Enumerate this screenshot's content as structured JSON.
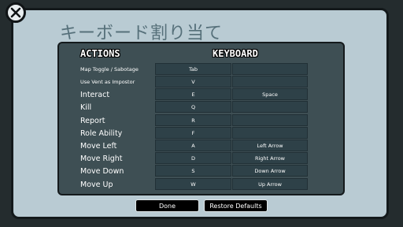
{
  "title": "キーボード割り当て",
  "headers": {
    "actions": "ACTIONS",
    "keyboard": "KEYBOARD"
  },
  "rows": [
    {
      "action": "Map Toggle / Sabotage",
      "key1": "Tab",
      "key2": ""
    },
    {
      "action": "Use Vent as Impostor",
      "key1": "V",
      "key2": ""
    },
    {
      "action": "Interact",
      "key1": "E",
      "key2": "Space"
    },
    {
      "action": "Kill",
      "key1": "Q",
      "key2": ""
    },
    {
      "action": "Report",
      "key1": "R",
      "key2": ""
    },
    {
      "action": "Role Ability",
      "key1": "F",
      "key2": ""
    },
    {
      "action": "Move Left",
      "key1": "A",
      "key2": "Left Arrow"
    },
    {
      "action": "Move Right",
      "key1": "D",
      "key2": "Right Arrow"
    },
    {
      "action": "Move Down",
      "key1": "S",
      "key2": "Down Arrow"
    },
    {
      "action": "Move Up",
      "key1": "W",
      "key2": "Up Arrow"
    }
  ],
  "buttons": {
    "done": "Done",
    "restore": "Restore Defaults"
  },
  "icons": {
    "close": "close-icon"
  },
  "colors": {
    "panel": "#b9cbd3",
    "inner": "#3e4f54",
    "key_cell": "#2e4148",
    "title": "#56707a"
  }
}
